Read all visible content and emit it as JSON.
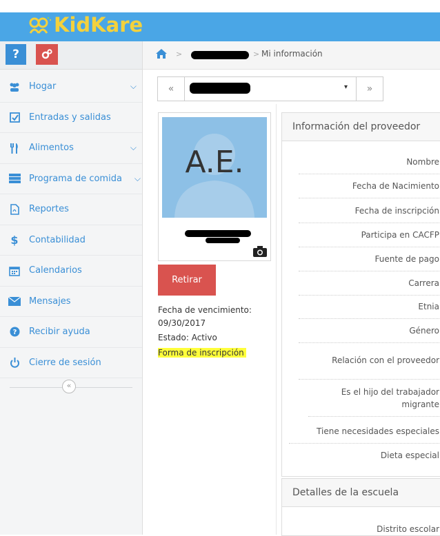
{
  "app": {
    "logo_text": "KidKare",
    "brand_color": "#4aa6e6",
    "logo_color": "#f3d13d"
  },
  "toolbar": {
    "help_label": "?",
    "settings_icon": "gears-icon"
  },
  "sidebar": {
    "items": [
      {
        "label": "Hogar",
        "icon": "users-icon",
        "has_chevron": true
      },
      {
        "label": "Entradas y salidas",
        "icon": "checkbox-icon",
        "has_chevron": false
      },
      {
        "label": "Alimentos",
        "icon": "utensils-icon",
        "has_chevron": true
      },
      {
        "label": "Programa de comida",
        "icon": "menu-list-icon",
        "has_chevron": true
      },
      {
        "label": "Reportes",
        "icon": "file-icon",
        "has_chevron": false
      },
      {
        "label": "Contabilidad",
        "icon": "dollar-icon",
        "has_chevron": false
      },
      {
        "label": "Calendarios",
        "icon": "calendar-icon",
        "has_chevron": false
      },
      {
        "label": "Mensajes",
        "icon": "envelope-icon",
        "has_chevron": false
      },
      {
        "label": "Recibir ayuda",
        "icon": "question-circle-icon",
        "has_chevron": false
      },
      {
        "label": "Cierre de sesión",
        "icon": "power-icon",
        "has_chevron": false
      }
    ],
    "collapse_glyph": "«"
  },
  "breadcrumb": {
    "separator": ">",
    "current": "Mi información"
  },
  "selector": {
    "prev": "«",
    "caret": "▾",
    "next": "»"
  },
  "profile": {
    "initials": "A.E.",
    "retire_button": "Retirar",
    "expiration_label": "Fecha de vencimiento:",
    "expiration_date": "09/30/2017",
    "status": "Estado: Activo",
    "enrollment_link": "Forma de inscripción"
  },
  "provider_panel": {
    "title": "Información del proveedor",
    "rows": [
      "Nombre",
      "Fecha de Nacimiento",
      "Fecha de inscripción",
      "Participa en CACFP",
      "Fuente de pago",
      "Carrera",
      "Etnia",
      "Género",
      "Relación con el proveedor",
      "Es el hijo del trabajador migrante",
      "Tiene necesidades especiales",
      "Dieta especial"
    ]
  },
  "school_panel": {
    "title": "Detalles de la escuela",
    "rows": [
      "Distrito escolar"
    ]
  }
}
